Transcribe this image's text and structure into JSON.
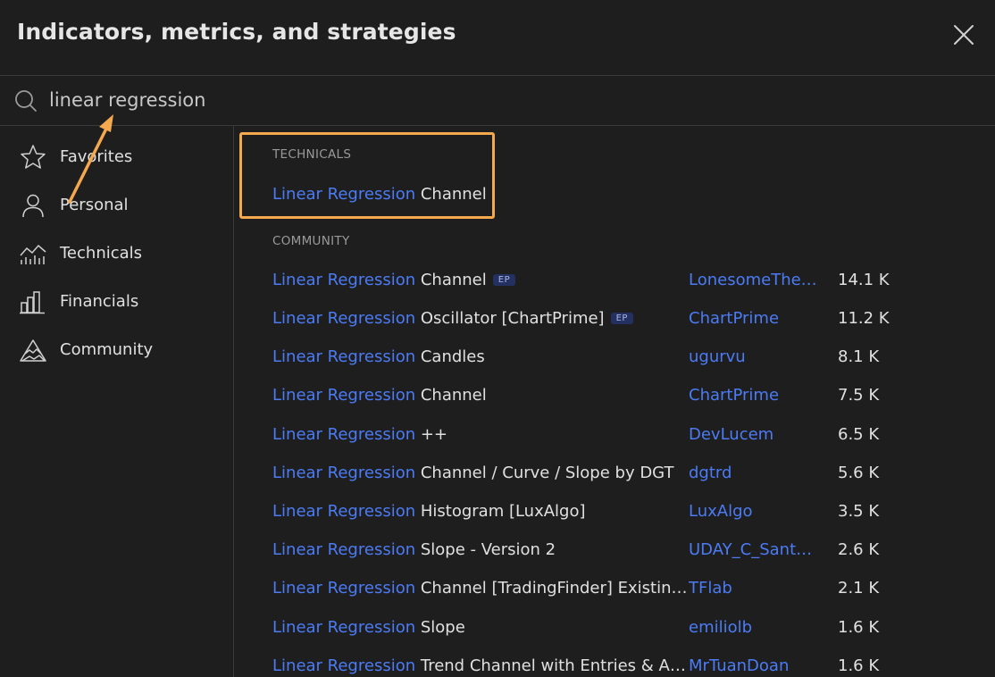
{
  "header": {
    "title": "Indicators, metrics, and strategies",
    "close_icon": "close-icon"
  },
  "search": {
    "value": "linear regression",
    "icon": "search-icon"
  },
  "sidebar": {
    "items": [
      {
        "label": "Favorites",
        "icon": "star-icon"
      },
      {
        "label": "Personal",
        "icon": "user-icon"
      },
      {
        "label": "Technicals",
        "icon": "technicals-chart-icon"
      },
      {
        "label": "Financials",
        "icon": "bar-chart-icon"
      },
      {
        "label": "Community",
        "icon": "community-mountain-icon"
      }
    ]
  },
  "technicals": {
    "section_label": "TECHNICALS",
    "items": [
      {
        "match": "Linear Regression",
        "rest": " Channel"
      }
    ]
  },
  "community": {
    "section_label": "COMMUNITY",
    "badge_text": "EP",
    "items": [
      {
        "match": "Linear Regression",
        "rest": " Channel",
        "badge": true,
        "author": "LonesomeThe…",
        "count": "14.1 K"
      },
      {
        "match": "Linear Regression",
        "rest": " Oscillator [ChartPrime]",
        "badge": true,
        "author": "ChartPrime",
        "count": "11.2 K"
      },
      {
        "match": "Linear Regression",
        "rest": " Candles",
        "badge": false,
        "author": "ugurvu",
        "count": "8.1 K"
      },
      {
        "match": "Linear Regression",
        "rest": " Channel",
        "badge": false,
        "author": "ChartPrime",
        "count": "7.5 K"
      },
      {
        "match": "Linear Regression",
        "rest": " ++",
        "badge": false,
        "author": "DevLucem",
        "count": "6.5 K"
      },
      {
        "match": "Linear Regression",
        "rest": " Channel / Curve / Slope by DGT",
        "badge": false,
        "author": "dgtrd",
        "count": "5.6 K"
      },
      {
        "match": "Linear Regression",
        "rest": " Histogram [LuxAlgo]",
        "badge": false,
        "author": "LuxAlgo",
        "count": "3.5 K"
      },
      {
        "match": "Linear Regression",
        "rest": " Slope - Version 2",
        "badge": false,
        "author": "UDAY_C_Sant…",
        "count": "2.6 K"
      },
      {
        "match": "Linear Regression",
        "rest": " Channel [TradingFinder] Existin…",
        "badge": false,
        "author": "TFlab",
        "count": "2.1 K"
      },
      {
        "match": "Linear Regression",
        "rest": " Slope",
        "badge": false,
        "author": "emiliolb",
        "count": "1.6 K"
      },
      {
        "match": "Linear Regression",
        "rest": " Trend Channel with Entries & A…",
        "badge": false,
        "author": "MrTuanDoan",
        "count": "1.6 K"
      }
    ]
  },
  "colors": {
    "background": "#1e1e1e",
    "match_text": "#4b7bf5",
    "highlight_annotation": "#f4a94e",
    "arrow_annotation": "#f4a94e"
  }
}
